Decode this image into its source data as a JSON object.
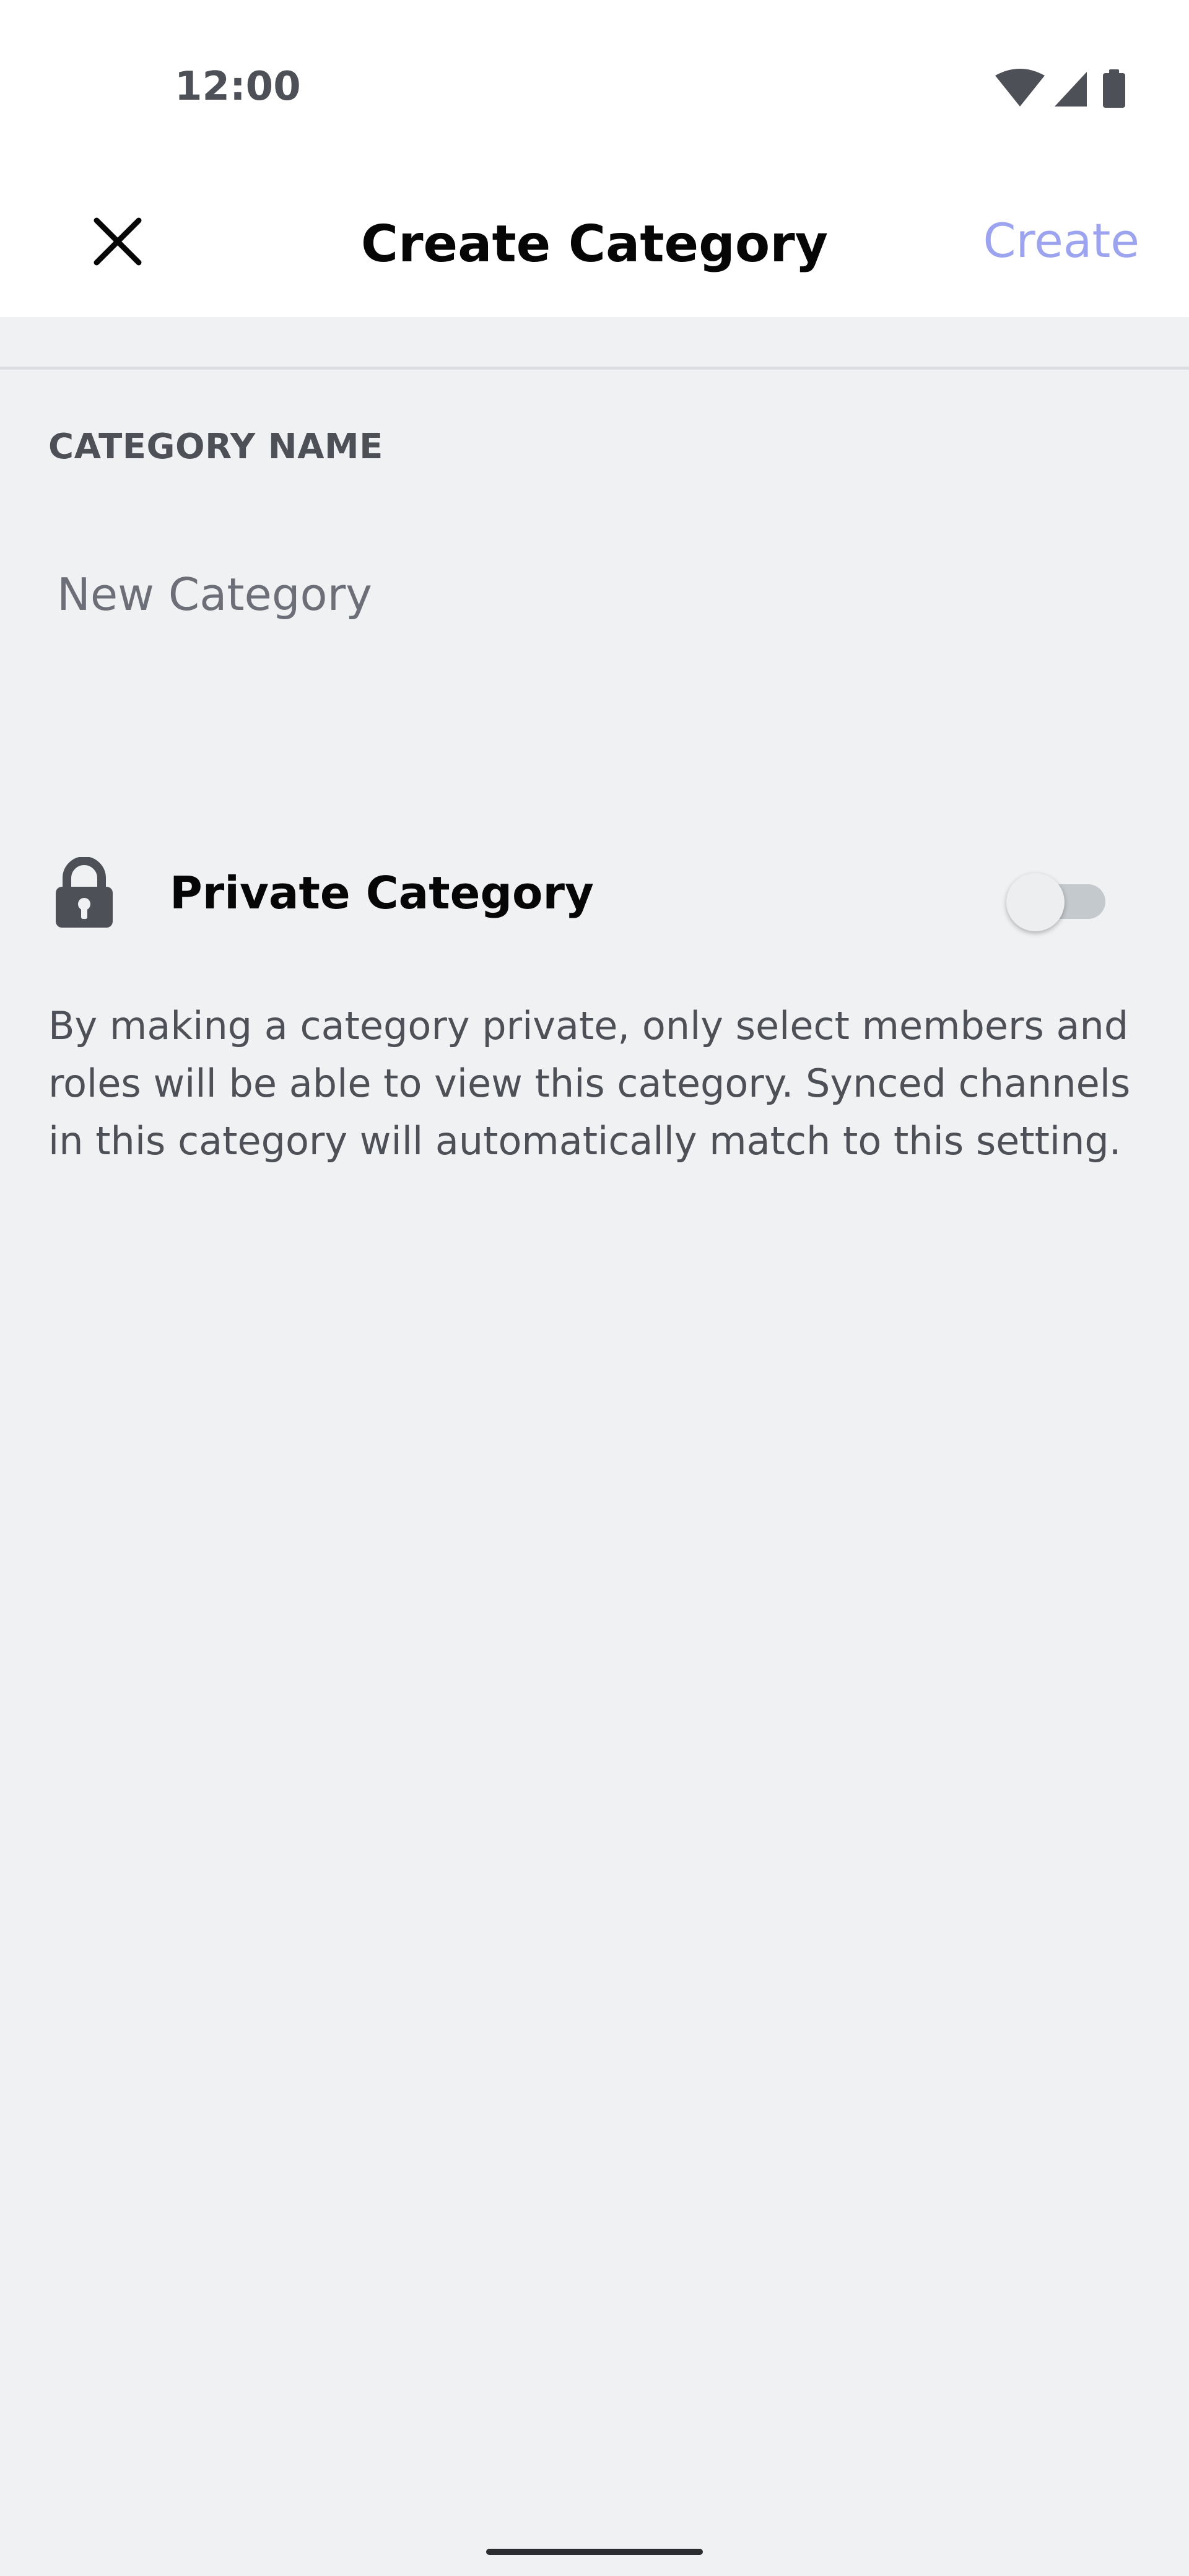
{
  "status_bar": {
    "time": "12:00",
    "icons": [
      "wifi-icon",
      "cellular-signal-icon",
      "battery-icon"
    ]
  },
  "app_bar": {
    "close_icon": "close-icon",
    "title": "Create Category",
    "create_label": "Create"
  },
  "form": {
    "category_name_label": "CATEGORY NAME",
    "category_name_value": "",
    "category_name_placeholder": "New Category",
    "private_icon": "lock-icon",
    "private_label": "Private Category",
    "private_enabled": false,
    "private_description": "By making a category private, only select members and roles will be able to view this category. Synced channels in this category will automatically match to this setting."
  },
  "colors": {
    "background": "#f0f1f3",
    "surface": "#ffffff",
    "accent_disabled": "#9da4ef",
    "text_primary": "#060607",
    "text_secondary": "#4e5058"
  }
}
